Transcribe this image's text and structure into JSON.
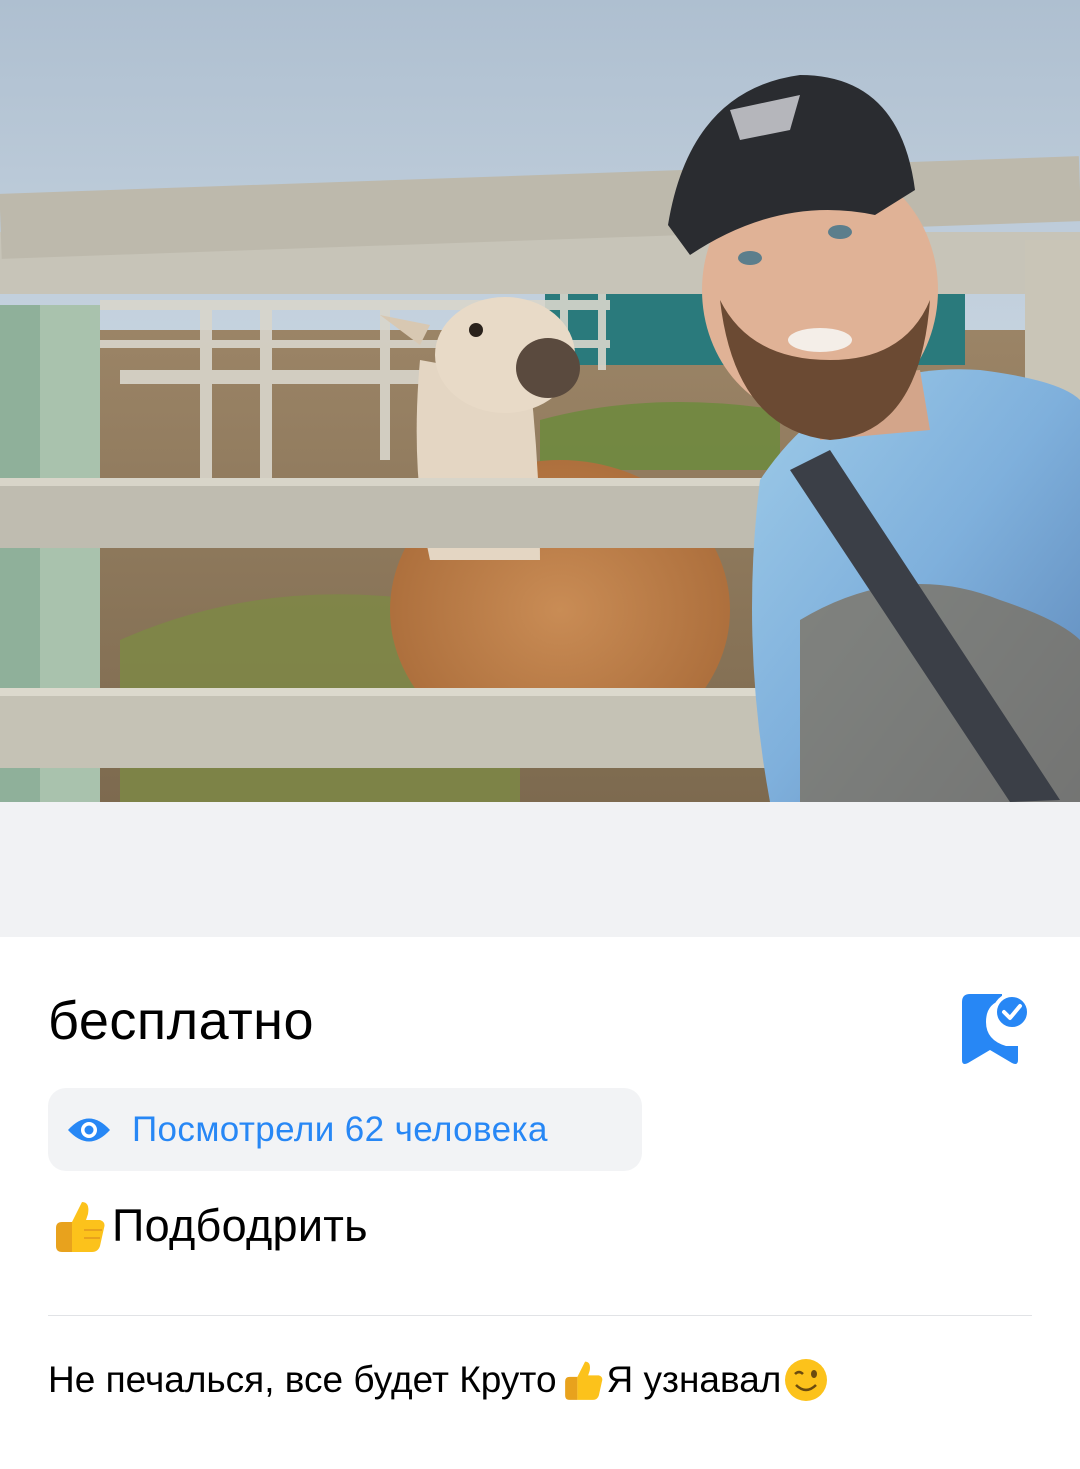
{
  "post": {
    "price": "бесплатно",
    "views_text": "Посмотрели 62 человека",
    "cheer_label": "Подбодрить",
    "comment": {
      "part1": "Не печалься, все будет Круто",
      "part2": "Я узнавал"
    }
  },
  "icons": {
    "bookmark": "bookmark-check-icon",
    "views": "eye-icon",
    "cheer": "thumbs-up-emoji",
    "wink": "winking-face-emoji"
  },
  "colors": {
    "accent": "#2787f5",
    "chip_bg": "#f2f3f5",
    "media_bg": "#f1f2f4",
    "divider": "#e1e3e6"
  }
}
